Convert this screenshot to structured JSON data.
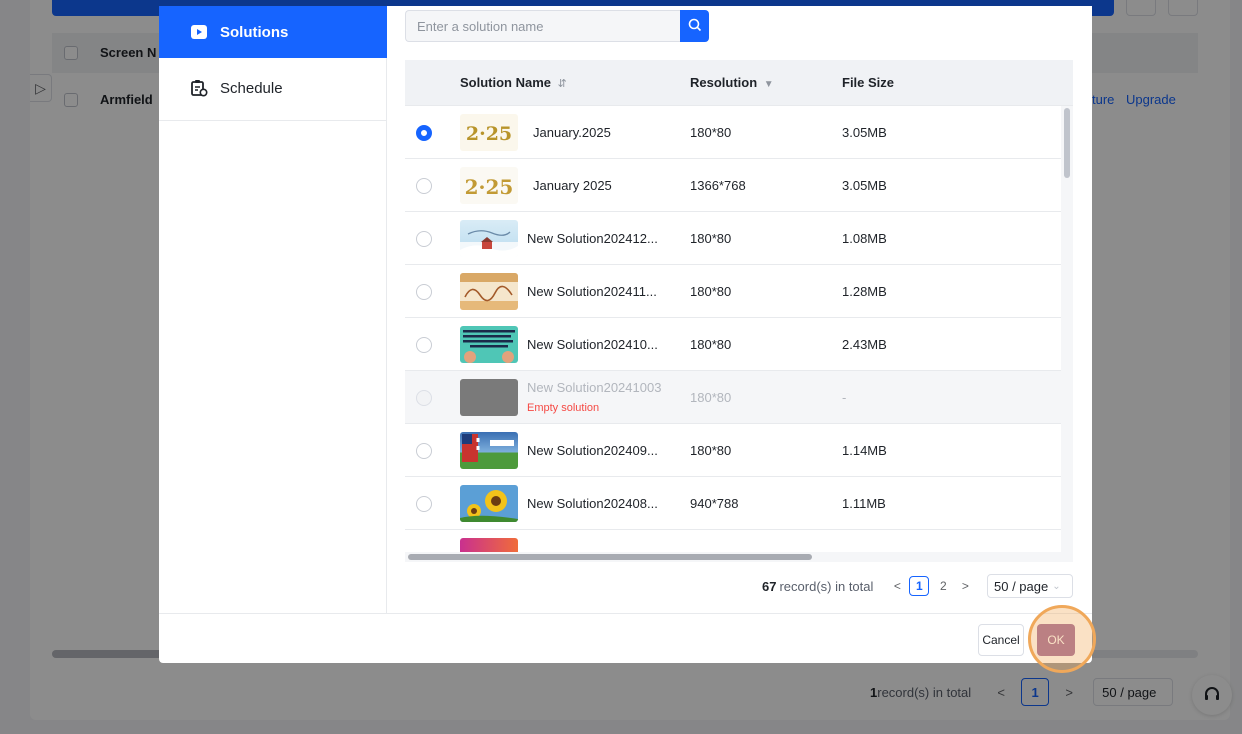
{
  "background": {
    "table_header": {
      "screen_name": "Screen N"
    },
    "row": {
      "name": "Armfield",
      "links": [
        "ture",
        "Upgrade"
      ]
    },
    "collapse_icon": "collapse-right-icon",
    "pagination": {
      "total_count": "1",
      "total_suffix": " record(s) in total",
      "prev": "<",
      "page": "1",
      "next": ">",
      "page_size": "50 / page"
    },
    "support_icon": "headset-icon"
  },
  "modal": {
    "sidebar": {
      "items": [
        {
          "label": "Solutions",
          "icon": "play-icon",
          "active": true
        },
        {
          "label": "Schedule",
          "icon": "schedule-icon",
          "active": false
        }
      ]
    },
    "search": {
      "placeholder": "Enter a solution name",
      "icon": "search-icon"
    },
    "table": {
      "columns": {
        "name": "Solution Name",
        "name_sort_icon": "sort-icon",
        "resolution": "Resolution",
        "resolution_filter_icon": "filter-icon",
        "size": "File Size"
      },
      "rows": [
        {
          "name": "January.2025",
          "resolution": "180*80",
          "size": "3.05MB",
          "selected": true,
          "thumb": "thumb-2025-a"
        },
        {
          "name": "January 2025",
          "resolution": "1366*768",
          "size": "3.05MB",
          "selected": false,
          "thumb": "thumb-2025-b"
        },
        {
          "name": "New Solution202412...",
          "resolution": "180*80",
          "size": "1.08MB",
          "selected": false,
          "thumb": "thumb-december"
        },
        {
          "name": "New Solution202411...",
          "resolution": "180*80",
          "size": "1.28MB",
          "selected": false,
          "thumb": "thumb-hello"
        },
        {
          "name": "New Solution202410...",
          "resolution": "180*80",
          "size": "2.43MB",
          "selected": false,
          "thumb": "thumb-teal-text"
        },
        {
          "name": "New Solution20241003",
          "note": "Empty solution",
          "resolution": "180*80",
          "size": "-",
          "selected": false,
          "disabled": true,
          "thumb": "thumb-empty"
        },
        {
          "name": "New Solution202409...",
          "resolution": "180*80",
          "size": "1.14MB",
          "selected": false,
          "thumb": "thumb-labor-day"
        },
        {
          "name": "New Solution202408...",
          "resolution": "940*788",
          "size": "1.11MB",
          "selected": false,
          "thumb": "thumb-sunflower"
        }
      ]
    },
    "pagination": {
      "total": "67",
      "total_suffix": "record(s) in total",
      "prev": "<",
      "pages": [
        "1",
        "2"
      ],
      "current": "1",
      "next": ">",
      "page_size": "50 / page"
    },
    "footer": {
      "cancel": "Cancel",
      "ok": "OK"
    }
  },
  "colors": {
    "primary": "#1664ff",
    "ok_button": "#9e6a9a",
    "highlight": "#f0a85a",
    "danger_text": "#f54a45"
  }
}
